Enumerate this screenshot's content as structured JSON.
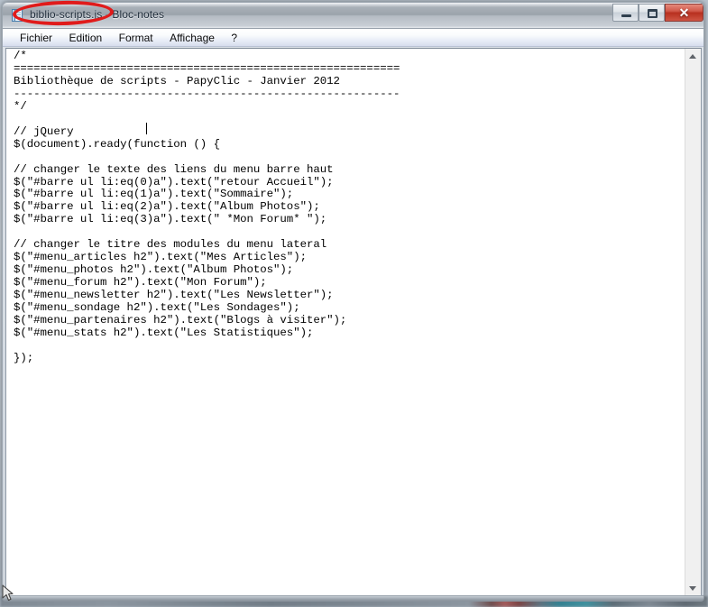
{
  "window": {
    "title": "biblio-scripts.js - Bloc-notes",
    "icon": "notepad-icon",
    "controls": {
      "minimize_label": "—",
      "maximize_label": "□",
      "close_label": "✕"
    }
  },
  "menu_bar": {
    "items": [
      {
        "label": "Fichier"
      },
      {
        "label": "Edition"
      },
      {
        "label": "Format"
      },
      {
        "label": "Affichage"
      },
      {
        "label": "?"
      }
    ]
  },
  "editor": {
    "text": "/*\n==========================================================\nBibliothèque de scripts - PapyClic - Janvier 2012\n----------------------------------------------------------\n*/\n\n// jQuery\n$(document).ready(function () {\n\n// changer le texte des liens du menu barre haut\n$(\"#barre ul li:eq(0)a\").text(\"retour Accueil\");\n$(\"#barre ul li:eq(1)a\").text(\"Sommaire\");\n$(\"#barre ul li:eq(2)a\").text(\"Album Photos\");\n$(\"#barre ul li:eq(3)a\").text(\" *Mon Forum* \");\n\n// changer le titre des modules du menu lateral\n$(\"#menu_articles h2\").text(\"Mes Articles\");\n$(\"#menu_photos h2\").text(\"Album Photos\");\n$(\"#menu_forum h2\").text(\"Mon Forum\");\n$(\"#menu_newsletter h2\").text(\"Les Newsletter\");\n$(\"#menu_sondage h2\").text(\"Les Sondages\");\n$(\"#menu_partenaires h2\").text(\"Blogs à visiter\");\n$(\"#menu_stats h2\").text(\"Les Statistiques\");\n\n});"
  },
  "scrollbar": {
    "up_arrow": "scroll-up-arrow",
    "down_arrow": "scroll-down-arrow"
  },
  "annotation": {
    "shape": "red-ellipse",
    "color": "#e01b1b",
    "targets": "biblio-scripts.js -"
  }
}
